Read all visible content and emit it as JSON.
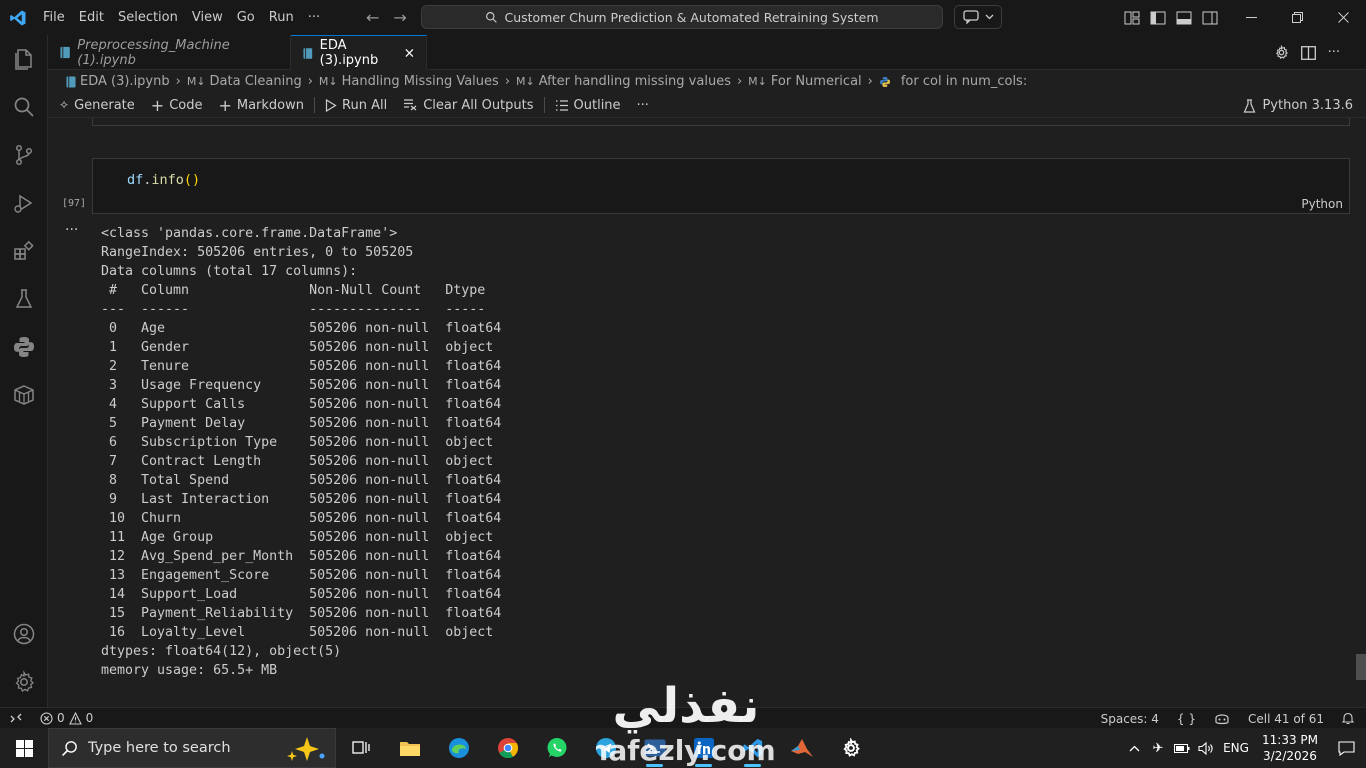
{
  "window": {
    "menu": [
      "File",
      "Edit",
      "Selection",
      "View",
      "Go",
      "Run",
      "···"
    ],
    "command_center": "Customer Churn Prediction & Automated Retraining System"
  },
  "tabs": [
    {
      "label": "Preprocessing_Machine (1).ipynb",
      "active": false
    },
    {
      "label": "EDA (3).ipynb",
      "active": true
    }
  ],
  "breadcrumbs": [
    "EDA (3).ipynb",
    "Data Cleaning",
    "Handling Missing Values",
    "After handling missing values",
    "For Numerical",
    "for col in num_cols:"
  ],
  "toolbar": {
    "generate": "Generate",
    "code": "Code",
    "markdown": "Markdown",
    "run_all": "Run All",
    "clear_outputs": "Clear All Outputs",
    "outline": "Outline",
    "more": "···",
    "kernel": "Python 3.13.6"
  },
  "cell": {
    "language": "Python",
    "execution_count": "[97]",
    "code_obj": "df",
    "code_method": "info",
    "code_parens": "()"
  },
  "output": {
    "line_class": "<class 'pandas.core.frame.DataFrame'>",
    "line_range": "RangeIndex: 505206 entries, 0 to 505205",
    "line_cols": "Data columns (total 17 columns):",
    "header": " #   Column               Non-Null Count   Dtype  ",
    "divider": "---  ------               --------------   -----  ",
    "rows": [
      " 0   Age                  505206 non-null  float64",
      " 1   Gender               505206 non-null  object ",
      " 2   Tenure               505206 non-null  float64",
      " 3   Usage Frequency      505206 non-null  float64",
      " 4   Support Calls        505206 non-null  float64",
      " 5   Payment Delay        505206 non-null  float64",
      " 6   Subscription Type    505206 non-null  object ",
      " 7   Contract Length      505206 non-null  object ",
      " 8   Total Spend          505206 non-null  float64",
      " 9   Last Interaction     505206 non-null  float64",
      " 10  Churn                505206 non-null  float64",
      " 11  Age Group            505206 non-null  object ",
      " 12  Avg_Spend_per_Month  505206 non-null  float64",
      " 13  Engagement_Score     505206 non-null  float64",
      " 14  Support_Load         505206 non-null  float64",
      " 15  Payment_Reliability  505206 non-null  float64",
      " 16  Loyalty_Level        505206 non-null  object "
    ],
    "dtypes": "dtypes: float64(12), object(5)",
    "memory": "memory usage: 65.5+ MB"
  },
  "status": {
    "errors": "0",
    "warnings": "0",
    "spaces": "Spaces: 4",
    "braces": "{ }",
    "cell_pos": "Cell 41 of 61"
  },
  "taskbar": {
    "search_placeholder": "Type here to search",
    "lang": "ENG",
    "time": "11:33 PM",
    "date": "3/2/2026"
  },
  "watermark": {
    "text_ar": "نفذلي",
    "text_en": "nafezly.com"
  },
  "colors": {
    "accent": "#0078d4",
    "code_method": "#dcdcaa",
    "code_var": "#9cdcfe"
  }
}
